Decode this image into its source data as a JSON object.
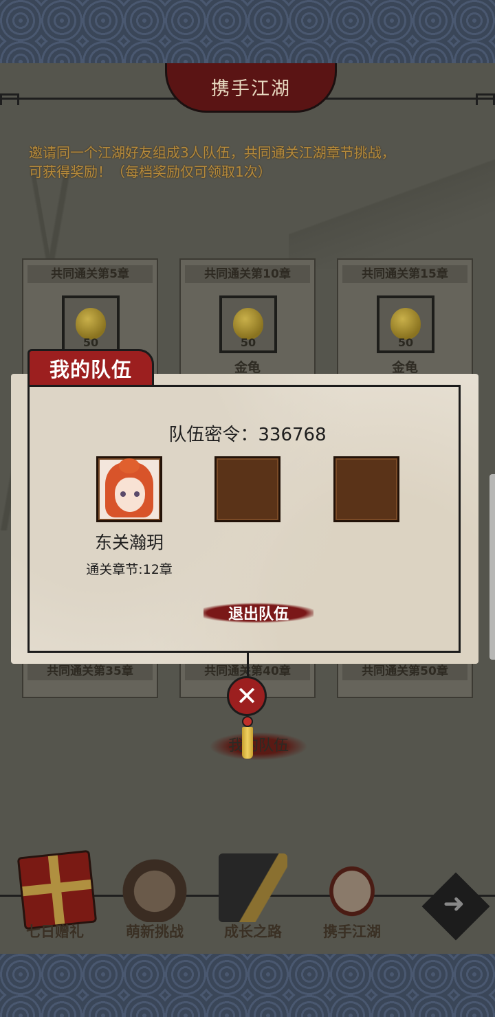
{
  "header": {
    "title": "携手江湖"
  },
  "intro": {
    "line1": "邀请同一个江湖好友组成3人队伍，共同通关江湖章节挑战，",
    "line2": "可获得奖励！（每档奖励仅可领取1次）"
  },
  "rewards": [
    {
      "title": "共同通关第5章",
      "qty": "50",
      "name": "金龟"
    },
    {
      "title": "共同通关第10章",
      "qty": "50",
      "name": "金龟"
    },
    {
      "title": "共同通关第15章",
      "qty": "50",
      "name": "金龟"
    }
  ],
  "rewards_row2": [
    {
      "title": "共同通关第35章"
    },
    {
      "title": "共同通关第40章"
    },
    {
      "title": "共同通关第50章"
    }
  ],
  "behind_button": "我的队伍",
  "dialog": {
    "title": "我的队伍",
    "passcode_label": "队伍密令：",
    "passcode": "336768",
    "member": {
      "name": "东关瀚玥",
      "progress": "通关章节:12章"
    },
    "leave_label": "退出队伍"
  },
  "nav": [
    {
      "label": "七日赠礼",
      "icon": "gift-box-icon"
    },
    {
      "label": "萌新挑战",
      "icon": "girl-portrait-icon"
    },
    {
      "label": "成长之路",
      "icon": "book-icon"
    },
    {
      "label": "携手江湖",
      "icon": "handshake-icon"
    }
  ],
  "colors": {
    "accent_red": "#9c1f1f",
    "parchment": "#e6dfd2",
    "gold_text": "#b58a3c"
  }
}
